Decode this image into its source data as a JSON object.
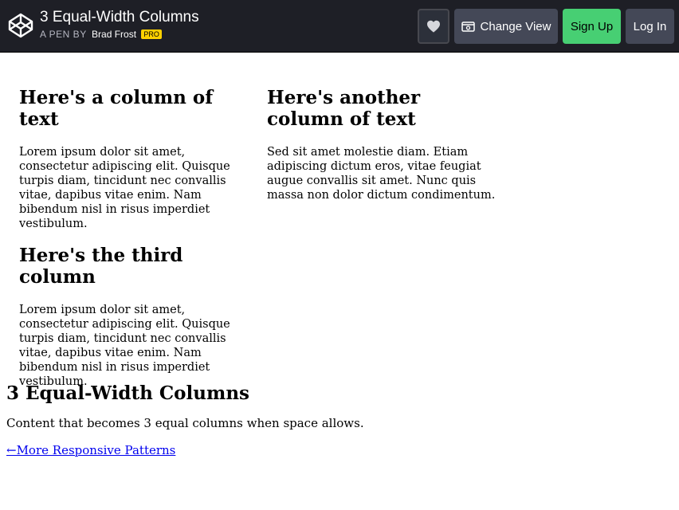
{
  "header": {
    "pen_title": "3 Equal-Width Columns",
    "byline_label": "A PEN BY",
    "author": "Brad Frost",
    "badge": "PRO",
    "buttons": {
      "heart_icon": "heart-icon",
      "change_view": "Change View",
      "sign_up": "Sign Up",
      "log_in": "Log In"
    }
  },
  "columns": [
    {
      "heading": "Here's a column of text",
      "body": "Lorem ipsum dolor sit amet, consectetur adipiscing elit. Quisque turpis diam, tincidunt nec convallis vitae, dapibus vitae enim. Nam bibendum nisl in risus imperdiet vestibulum."
    },
    {
      "heading": "Here's another column of text",
      "body": "Sed sit amet molestie diam. Etiam adipiscing dictum eros, vitae feugiat augue convallis sit amet. Nunc quis massa non dolor dictum condimentum."
    },
    {
      "heading": "Here's the third column",
      "body": "Lorem ipsum dolor sit amet, consectetur adipiscing elit. Quisque turpis diam, tincidunt nec convallis vitae, dapibus vitae enim. Nam bibendum nisl in risus imperdiet vestibulum."
    }
  ],
  "footer": {
    "title": "3 Equal-Width Columns",
    "description": "Content that becomes 3 equal columns when space allows.",
    "link": "←More Responsive Patterns"
  },
  "colors": {
    "header_bg": "#1e1f26",
    "signup_green": "#47cf73",
    "pro_yellow": "#fcd000",
    "button_gray": "#444857"
  }
}
